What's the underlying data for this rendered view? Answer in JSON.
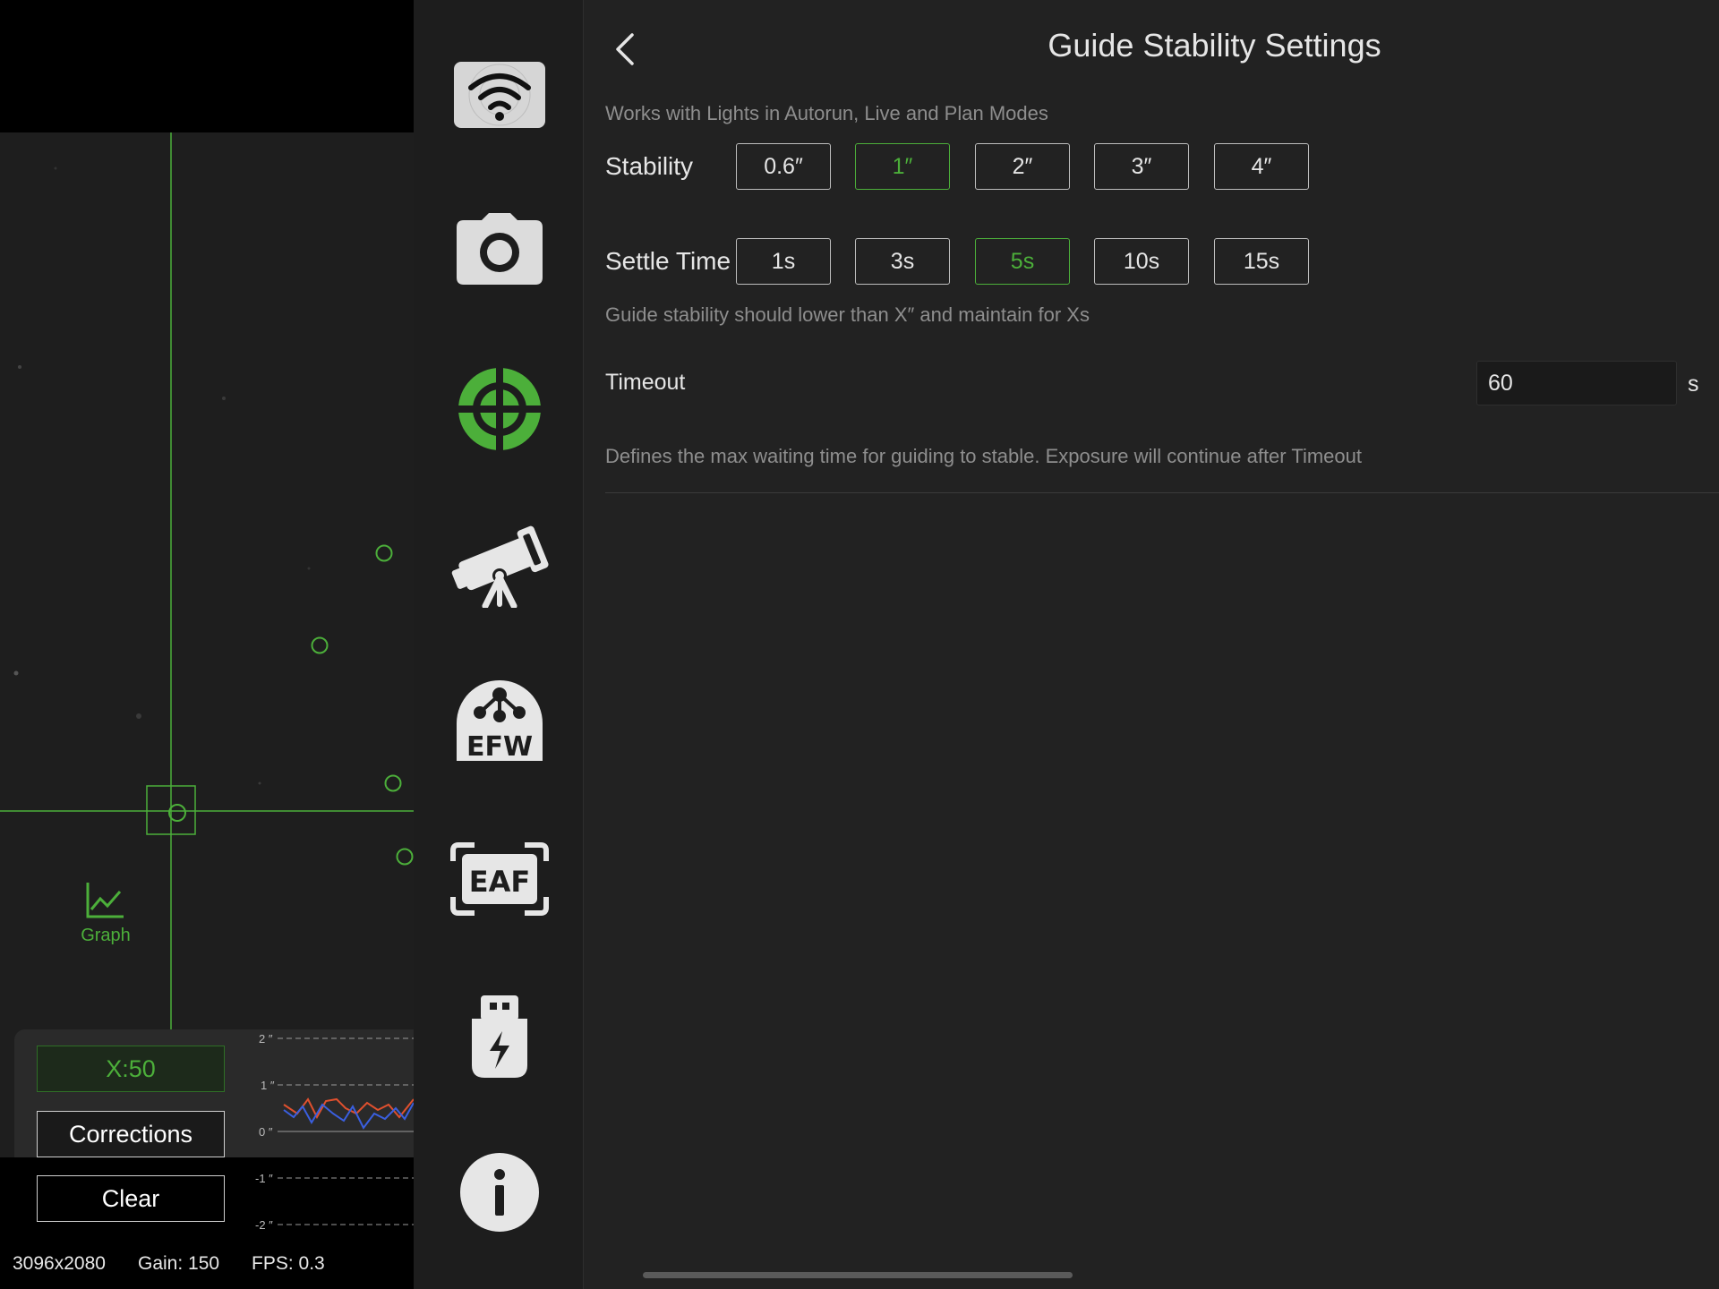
{
  "guide_view": {
    "graph_label": "Graph",
    "scale_label": "X:50",
    "corrections_label": "Corrections",
    "clear_label": "Clear",
    "graph_ticks": [
      "2 ″",
      "1 ″",
      "0 ″",
      "-1 ″",
      "-2 ″"
    ],
    "status": {
      "resolution": "3096x2080",
      "gain": "Gain: 150",
      "fps": "FPS: 0.3"
    }
  },
  "devices": [
    {
      "name": "wifi-icon"
    },
    {
      "name": "camera-icon"
    },
    {
      "name": "guide-icon",
      "active": true
    },
    {
      "name": "telescope-icon"
    },
    {
      "name": "efw-icon",
      "text": "EFW"
    },
    {
      "name": "eaf-icon",
      "text": "EAF"
    },
    {
      "name": "usb-power-icon"
    },
    {
      "name": "info-icon"
    }
  ],
  "settings": {
    "title": "Guide Stability Settings",
    "works_with": "Works with Lights in Autorun, Live and Plan Modes",
    "stability_label": "Stability",
    "stability_options": [
      "0.6″",
      "1″",
      "2″",
      "3″",
      "4″"
    ],
    "stability_selected": "1″",
    "settle_label": "Settle Time",
    "settle_options": [
      "1s",
      "3s",
      "5s",
      "10s",
      "15s"
    ],
    "settle_selected": "5s",
    "settle_hint": "Guide stability should lower than X″ and maintain for Xs",
    "timeout_label": "Timeout",
    "timeout_value": "60",
    "timeout_unit": "s",
    "timeout_hint": "Defines the max waiting time for guiding to stable. Exposure will continue after Timeout"
  },
  "colors": {
    "accent": "#4caf3a",
    "background": "#222222",
    "graph_ra": "#e0502e",
    "graph_dec": "#3a5fe0"
  }
}
